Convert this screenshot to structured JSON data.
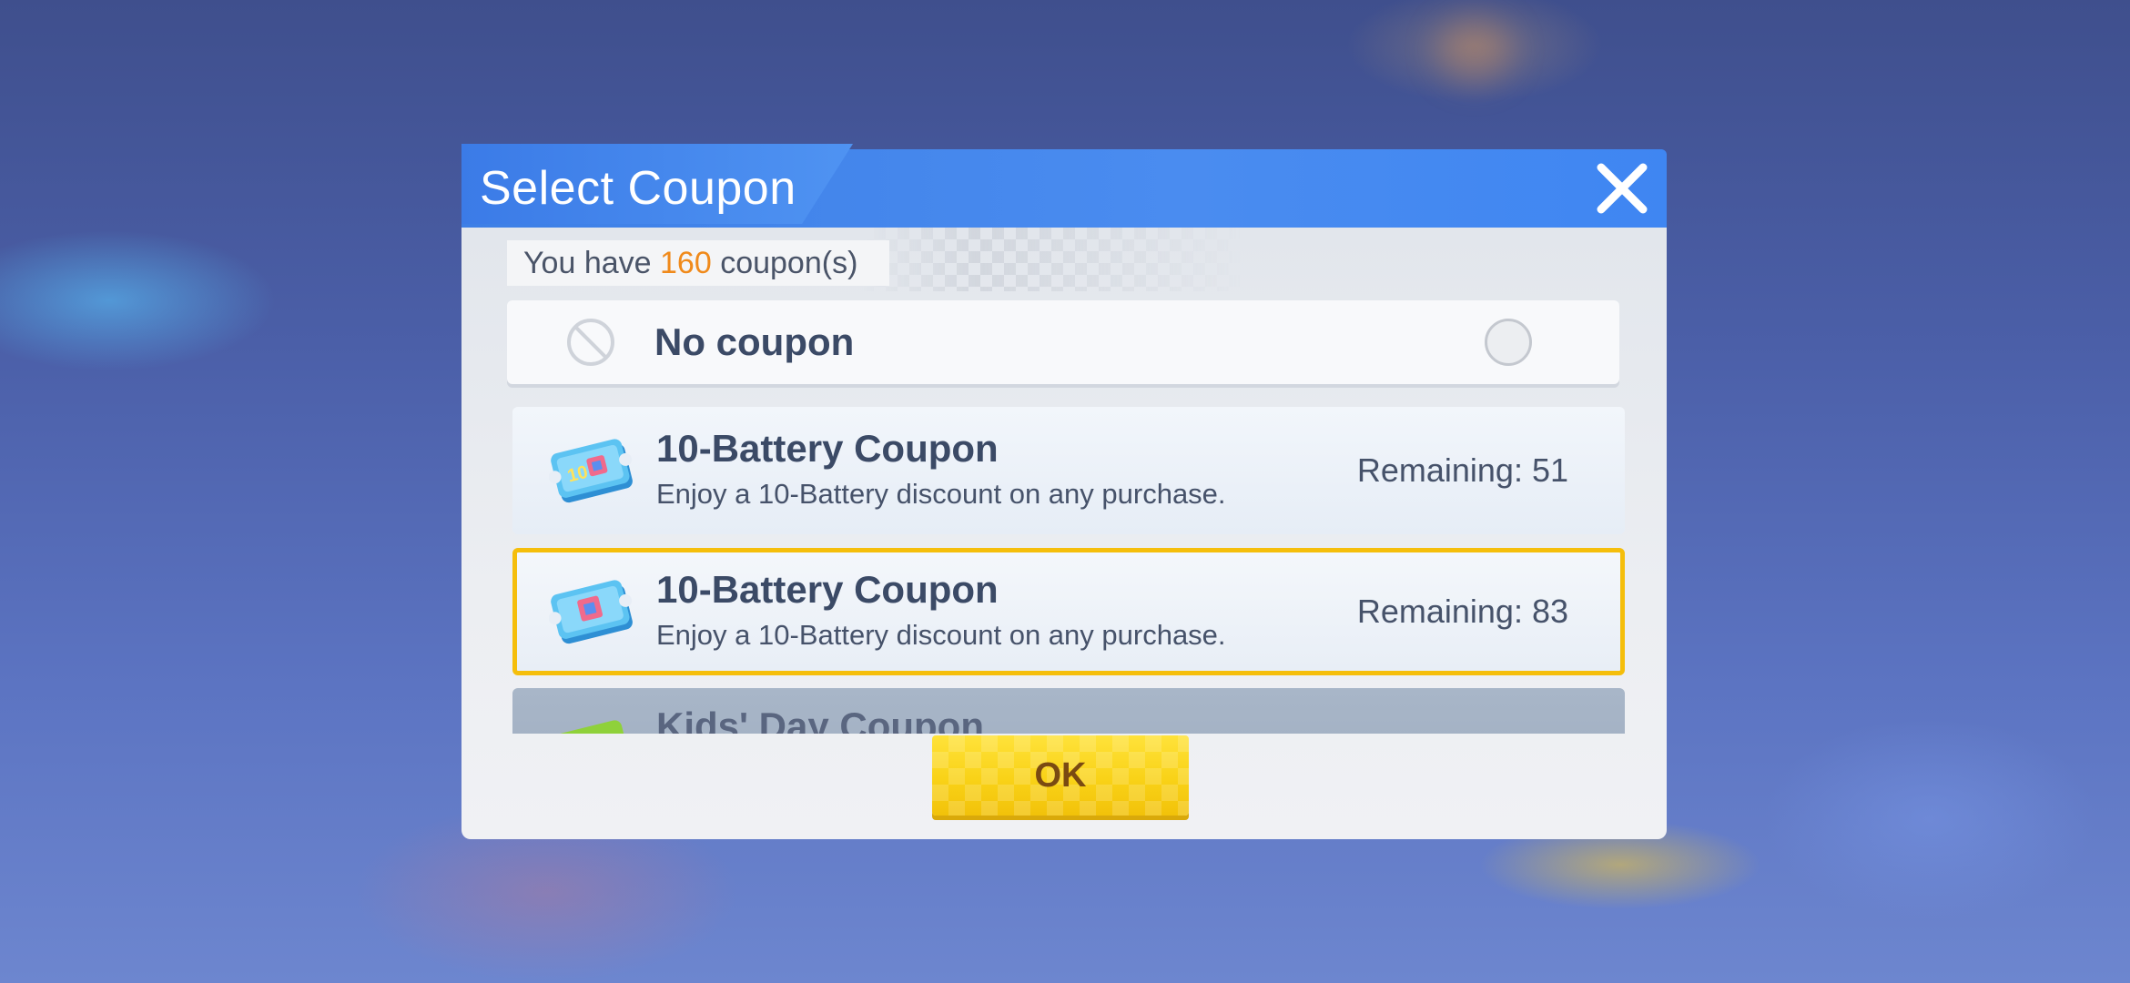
{
  "dialog": {
    "title": "Select Coupon",
    "close_icon": "close-icon"
  },
  "coupon_count": {
    "prefix": "You have",
    "count": "160",
    "suffix": "coupon(s)"
  },
  "no_coupon": {
    "label": "No coupon",
    "icon": "no-entry-icon",
    "selected": false
  },
  "coupons": [
    {
      "name": "10-Battery Coupon",
      "description": "Enjoy a 10-Battery discount on any purchase.",
      "remaining": "Remaining: 51",
      "icon": "battery-coupon-ticket-icon",
      "selected": false
    },
    {
      "name": "10-Battery Coupon",
      "description": "Enjoy a 10-Battery discount on any purchase.",
      "remaining": "Remaining: 83",
      "icon": "battery-coupon-ticket-icon",
      "selected": true
    },
    {
      "name": "Kids' Day Coupon",
      "icon": "kids-day-coupon-icon"
    }
  ],
  "ok_button": {
    "label": "OK"
  },
  "colors": {
    "header_blue": "#3f86f2",
    "count_highlight": "#f08a1b",
    "selected_border": "#f5be0b",
    "ok_yellow": "#f9d217"
  }
}
